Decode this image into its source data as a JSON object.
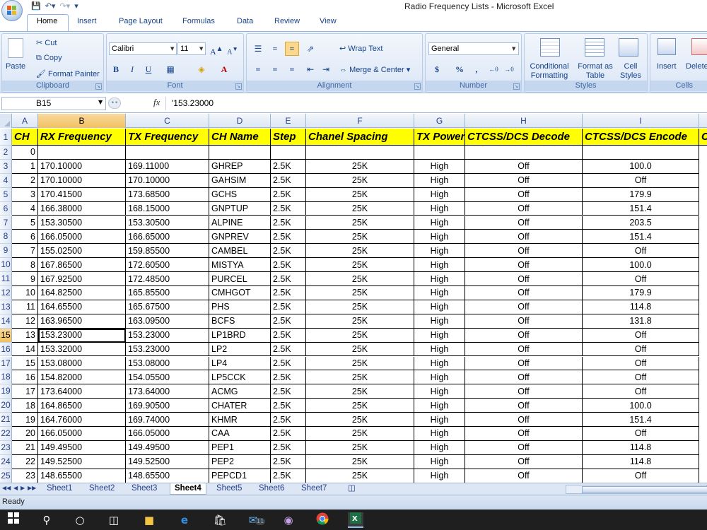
{
  "window": {
    "title": "Radio Frequency Lists - Microsoft Excel"
  },
  "ribbon": {
    "tabs": [
      "Home",
      "Insert",
      "Page Layout",
      "Formulas",
      "Data",
      "Review",
      "View"
    ],
    "clipboard": {
      "group": "Clipboard",
      "paste": "Paste",
      "cut": "Cut",
      "copy": "Copy",
      "format_painter": "Format Painter"
    },
    "font": {
      "group": "Font",
      "name": "Calibri",
      "size": "11"
    },
    "alignment": {
      "group": "Alignment",
      "wrap": "Wrap Text",
      "merge": "Merge & Center"
    },
    "number": {
      "group": "Number",
      "format": "General"
    },
    "styles": {
      "group": "Styles",
      "conditional": "Conditional Formatting",
      "format_table": "Format as Table",
      "cell_styles": "Cell Styles"
    },
    "cells": {
      "group": "Cells",
      "insert": "Insert",
      "delete": "Delete"
    }
  },
  "formula_bar": {
    "name_box": "B15",
    "fx": "fx",
    "formula": "'153.23000"
  },
  "columns": [
    "A",
    "B",
    "C",
    "D",
    "E",
    "F",
    "G",
    "H",
    "I"
  ],
  "header_row": [
    "CH",
    "RX Frequency",
    "TX Frequency",
    "CH Name",
    "Step",
    "Chanel Spacing",
    "TX Power",
    "CTCSS/DCS Decode",
    "CTCSS/DCS Encode",
    "C"
  ],
  "rows": [
    [
      "0",
      "",
      "",
      "",
      "",
      "",
      "",
      "",
      ""
    ],
    [
      "1",
      "170.10000",
      "169.11000",
      "GHREP",
      "2.5K",
      "25K",
      "High",
      "Off",
      "100.0"
    ],
    [
      "2",
      "170.10000",
      "170.10000",
      "GAHSIM",
      "2.5K",
      "25K",
      "High",
      "Off",
      "Off"
    ],
    [
      "3",
      "170.41500",
      "173.68500",
      "GCHS",
      "2.5K",
      "25K",
      "High",
      "Off",
      "179.9"
    ],
    [
      "4",
      "166.38000",
      "168.15000",
      "GNPTUP",
      "2.5K",
      "25K",
      "High",
      "Off",
      "151.4"
    ],
    [
      "5",
      "153.30500",
      "153.30500",
      "ALPINE",
      "2.5K",
      "25K",
      "High",
      "Off",
      "203.5"
    ],
    [
      "6",
      "166.05000",
      "166.65000",
      "GNPREV",
      "2.5K",
      "25K",
      "High",
      "Off",
      "151.4"
    ],
    [
      "7",
      "155.02500",
      "159.85500",
      "CAMBEL",
      "2.5K",
      "25K",
      "High",
      "Off",
      "Off"
    ],
    [
      "8",
      "167.86500",
      "172.60500",
      "MISTYA",
      "2.5K",
      "25K",
      "High",
      "Off",
      "100.0"
    ],
    [
      "9",
      "167.92500",
      "172.48500",
      "PURCEL",
      "2.5K",
      "25K",
      "High",
      "Off",
      "Off"
    ],
    [
      "10",
      "164.82500",
      "165.85500",
      "CMHGOT",
      "2.5K",
      "25K",
      "High",
      "Off",
      "179.9"
    ],
    [
      "11",
      "164.65500",
      "165.67500",
      "PHS",
      "2.5K",
      "25K",
      "High",
      "Off",
      "114.8"
    ],
    [
      "12",
      "163.96500",
      "163.09500",
      "BCFS",
      "2.5K",
      "25K",
      "High",
      "Off",
      "131.8"
    ],
    [
      "13",
      "153.23000",
      "153.23000",
      "LP1BRD",
      "2.5K",
      "25K",
      "High",
      "Off",
      "Off"
    ],
    [
      "14",
      "153.32000",
      "153.23000",
      "LP2",
      "2.5K",
      "25K",
      "High",
      "Off",
      "Off"
    ],
    [
      "15",
      "153.08000",
      "153.08000",
      "LP4",
      "2.5K",
      "25K",
      "High",
      "Off",
      "Off"
    ],
    [
      "16",
      "154.82000",
      "154.05500",
      "LP5CCK",
      "2.5K",
      "25K",
      "High",
      "Off",
      "Off"
    ],
    [
      "17",
      "173.64000",
      "173.64000",
      "ACMG",
      "2.5K",
      "25K",
      "High",
      "Off",
      "Off"
    ],
    [
      "18",
      "164.86500",
      "169.90500",
      "CHATER",
      "2.5K",
      "25K",
      "High",
      "Off",
      "100.0"
    ],
    [
      "19",
      "164.76000",
      "169.74000",
      "KHMR",
      "2.5K",
      "25K",
      "High",
      "Off",
      "151.4"
    ],
    [
      "20",
      "166.05000",
      "166.05000",
      "CAA",
      "2.5K",
      "25K",
      "High",
      "Off",
      "Off"
    ],
    [
      "21",
      "149.49500",
      "149.49500",
      "PEP1",
      "2.5K",
      "25K",
      "High",
      "Off",
      "114.8"
    ],
    [
      "22",
      "149.52500",
      "149.52500",
      "PEP2",
      "2.5K",
      "25K",
      "High",
      "Off",
      "114.8"
    ],
    [
      "23",
      "148.65500",
      "148.65500",
      "PEPCD1",
      "2.5K",
      "25K",
      "High",
      "Off",
      "Off"
    ]
  ],
  "sheets": [
    "Sheet1",
    "Sheet2",
    "Sheet3",
    "Sheet4",
    "Sheet5",
    "Sheet6",
    "Sheet7"
  ],
  "active_sheet": "Sheet4",
  "status": "Ready",
  "taskbar_badge": "11"
}
